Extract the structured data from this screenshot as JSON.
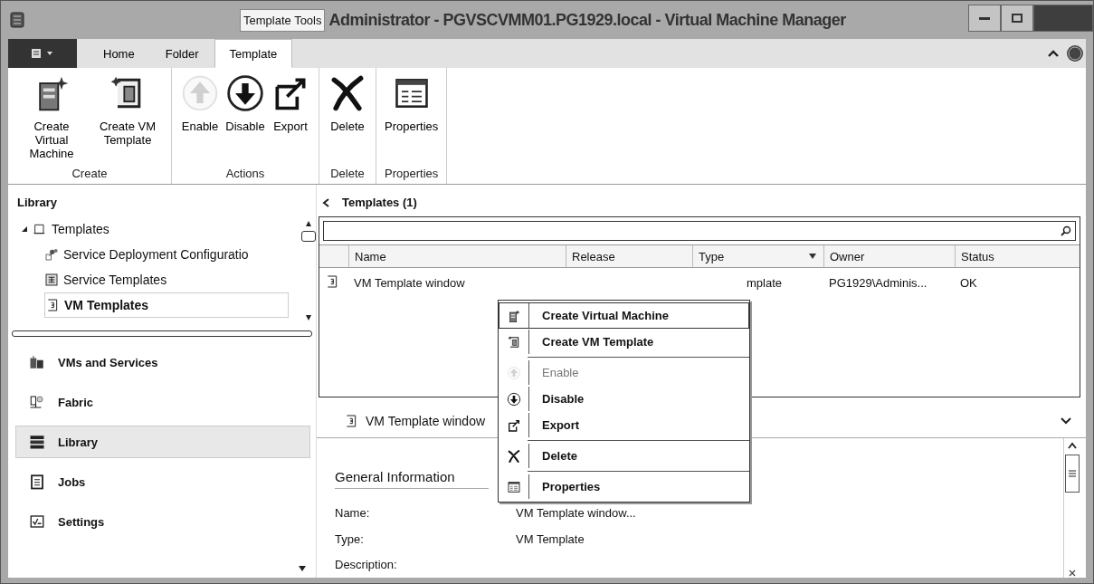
{
  "window": {
    "title": "Administrator - PGVSCVMM01.PG1929.local - Virtual Machine Manager",
    "contextual_tab": "Template Tools"
  },
  "ribbon_tabs": [
    {
      "label": "Home",
      "selected": false
    },
    {
      "label": "Folder",
      "selected": false
    },
    {
      "label": "Template",
      "selected": true
    }
  ],
  "ribbon_groups": [
    {
      "label": "Create",
      "buttons": [
        {
          "label": "Create Virtual Machine",
          "kind": "server",
          "disabled": false
        },
        {
          "label": "Create VM Template",
          "kind": "template",
          "disabled": false
        }
      ]
    },
    {
      "label": "Actions",
      "buttons": [
        {
          "label": "Enable",
          "kind": "up",
          "disabled": true
        },
        {
          "label": "Disable",
          "kind": "down",
          "disabled": false
        },
        {
          "label": "Export",
          "kind": "export",
          "disabled": false
        }
      ]
    },
    {
      "label": "Delete",
      "buttons": [
        {
          "label": "Delete",
          "kind": "delete",
          "disabled": false
        }
      ]
    },
    {
      "label": "Properties",
      "buttons": [
        {
          "label": "Properties",
          "kind": "properties",
          "disabled": false
        }
      ]
    }
  ],
  "sidebar": {
    "header": "Library",
    "tree": [
      {
        "label": "Templates",
        "kind": "folder",
        "expanded": true,
        "selected": false,
        "children": [
          {
            "label": "Service Deployment Configuratio",
            "kind": "deploy",
            "selected": false
          },
          {
            "label": "Service Templates",
            "kind": "service",
            "selected": false
          },
          {
            "label": "VM Templates",
            "kind": "vmtemplate",
            "selected": true
          }
        ]
      }
    ],
    "workspaces": [
      {
        "label": "VMs and Services",
        "kind": "vms",
        "selected": false
      },
      {
        "label": "Fabric",
        "kind": "fabric",
        "selected": false
      },
      {
        "label": "Library",
        "kind": "library",
        "selected": true
      },
      {
        "label": "Jobs",
        "kind": "jobs",
        "selected": false
      },
      {
        "label": "Settings",
        "kind": "settings",
        "selected": false
      }
    ]
  },
  "main": {
    "title": "Templates (1)",
    "table": {
      "columns": [
        {
          "label": "Name",
          "sorted": false
        },
        {
          "label": "Release",
          "sorted": false
        },
        {
          "label": "Type",
          "sorted": true
        },
        {
          "label": "Owner",
          "sorted": false
        },
        {
          "label": "Status",
          "sorted": false
        }
      ],
      "rows": [
        {
          "kind": "vmtemplate",
          "name": "VM Template window",
          "type": "mplate",
          "owner": "PG1929\\Adminis...",
          "status": "OK"
        }
      ]
    },
    "details": {
      "header": "VM Template window",
      "section": "General Information",
      "fields": [
        {
          "label": "Name:",
          "value": "VM Template window..."
        },
        {
          "label": "Type:",
          "value": "VM Template"
        },
        {
          "label": "Description:"
        }
      ]
    }
  },
  "context_menu": [
    {
      "kind": "server",
      "label": "Create Virtual Machine",
      "disabled": false,
      "selected": true
    },
    {
      "kind": "template",
      "label": "Create VM Template",
      "disabled": false,
      "selected": false
    },
    {
      "kind": "separator"
    },
    {
      "kind": "up",
      "label": "Enable",
      "disabled": true,
      "selected": false
    },
    {
      "kind": "down",
      "label": "Disable",
      "disabled": false,
      "selected": false
    },
    {
      "kind": "export",
      "label": "Export",
      "disabled": false,
      "selected": false
    },
    {
      "kind": "separator"
    },
    {
      "kind": "delete",
      "label": "Delete",
      "disabled": false,
      "selected": false
    },
    {
      "kind": "separator"
    },
    {
      "kind": "properties",
      "label": "Properties",
      "disabled": false,
      "selected": false
    }
  ]
}
